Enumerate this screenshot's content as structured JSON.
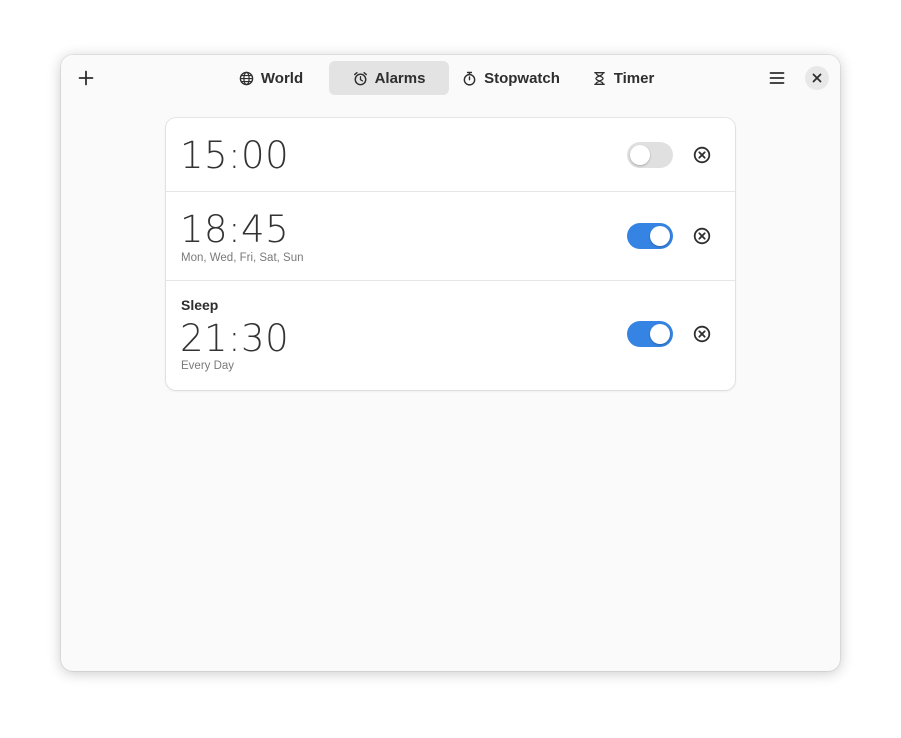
{
  "header": {
    "add_icon": "plus-icon",
    "menu_icon": "hamburger-menu-icon",
    "close_icon": "close-icon",
    "tabs": [
      {
        "label": "World",
        "icon": "globe-icon",
        "active": false
      },
      {
        "label": "Alarms",
        "icon": "alarm-clock-icon",
        "active": true
      },
      {
        "label": "Stopwatch",
        "icon": "stopwatch-icon",
        "active": false
      },
      {
        "label": "Timer",
        "icon": "hourglass-icon",
        "active": false
      }
    ]
  },
  "alarms": [
    {
      "name": "",
      "time": "15:00",
      "days": "",
      "enabled": false
    },
    {
      "name": "",
      "time": "18:45",
      "days": "Mon, Wed, Fri, Sat, Sun",
      "enabled": true
    },
    {
      "name": "Sleep",
      "time": "21:30",
      "days": "Every Day",
      "enabled": true
    }
  ],
  "colors": {
    "accent": "#3584e4",
    "switch_off": "#e0e0e0",
    "window_bg": "#fafafa",
    "list_bg": "#ffffff"
  }
}
